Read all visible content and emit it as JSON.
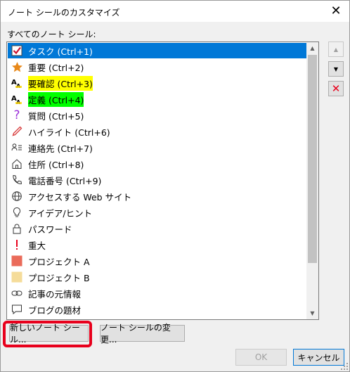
{
  "dialog": {
    "title": "ノート シールのカスタマイズ",
    "close_glyph": "✕",
    "list_label": "すべてのノート シール:"
  },
  "tags": [
    {
      "label": "タスク (Ctrl+1)",
      "icon": "checkbox-check-icon",
      "selected": true
    },
    {
      "label": "重要 (Ctrl+2)",
      "icon": "star-icon"
    },
    {
      "label": "要確認 (Ctrl+3)",
      "icon": "highlight-yellow-icon",
      "highlight": "yellow"
    },
    {
      "label": "定義 (Ctrl+4)",
      "icon": "highlight-green-icon",
      "highlight": "green"
    },
    {
      "label": "質問 (Ctrl+5)",
      "icon": "question-icon"
    },
    {
      "label": "ハイライト (Ctrl+6)",
      "icon": "pen-icon"
    },
    {
      "label": "連絡先 (Ctrl+7)",
      "icon": "contact-icon"
    },
    {
      "label": "住所 (Ctrl+8)",
      "icon": "home-icon"
    },
    {
      "label": "電話番号 (Ctrl+9)",
      "icon": "phone-icon"
    },
    {
      "label": "アクセスする Web サイト",
      "icon": "globe-icon"
    },
    {
      "label": "アイデア/ヒント",
      "icon": "lightbulb-icon"
    },
    {
      "label": "パスワード",
      "icon": "lock-icon"
    },
    {
      "label": "重大",
      "icon": "exclamation-icon"
    },
    {
      "label": "プロジェクト A",
      "icon": "red-square-icon"
    },
    {
      "label": "プロジェクト B",
      "icon": "yellow-square-icon"
    },
    {
      "label": "記事の元情報",
      "icon": "link-icon"
    },
    {
      "label": "ブログの題材",
      "icon": "speech-bubble-icon"
    }
  ],
  "side_buttons": {
    "up_glyph": "▲",
    "down_glyph": "▼",
    "delete_glyph": "✕"
  },
  "buttons": {
    "new_tag": "新しいノート シール...",
    "modify_tag": "ノート シールの変更...",
    "ok": "OK",
    "cancel": "キャンセル"
  },
  "colors": {
    "selection": "#0078d7",
    "task_red": "#c8102e",
    "star_orange": "#e8891a",
    "question_purple": "#9b30d9",
    "important_red": "#e8001c",
    "project_a": "#ea6b5a",
    "project_b": "#f5dc9a",
    "callout_red": "#e8001c"
  }
}
